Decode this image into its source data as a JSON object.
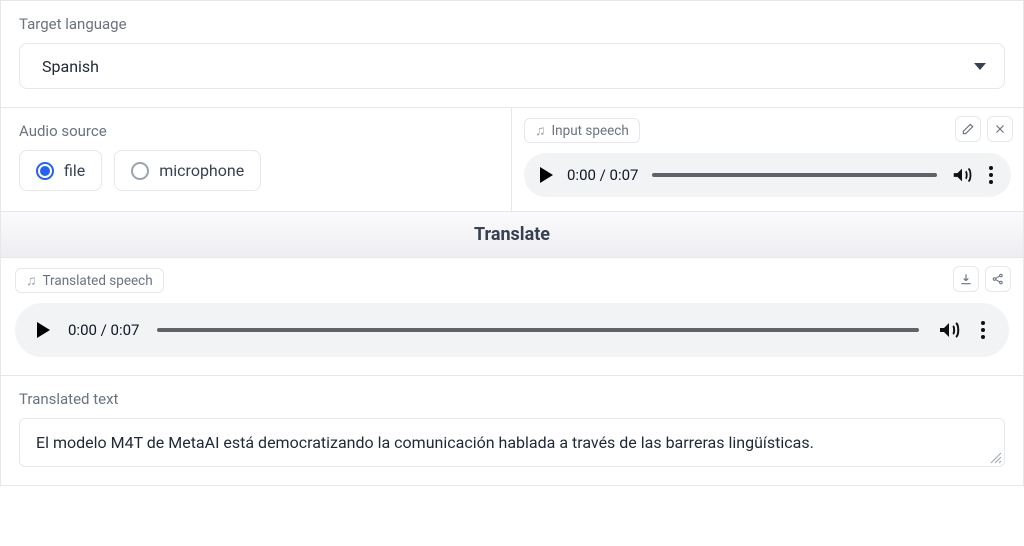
{
  "targetLanguage": {
    "label": "Target language",
    "value": "Spanish"
  },
  "audioSource": {
    "label": "Audio source",
    "options": [
      "file",
      "microphone"
    ],
    "selected": "file"
  },
  "inputSpeech": {
    "label": "Input speech",
    "time": "0:00 / 0:07"
  },
  "translateButton": "Translate",
  "translatedSpeech": {
    "label": "Translated speech",
    "time": "0:00 / 0:07"
  },
  "translatedText": {
    "label": "Translated text",
    "value": "El modelo M4T de MetaAI está democratizando la comunicación hablada a través de las barreras lingüísticas."
  }
}
